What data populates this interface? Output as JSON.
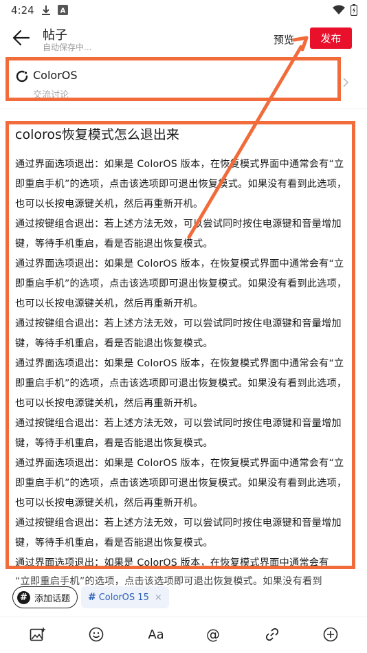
{
  "status_bar": {
    "time": "4:24"
  },
  "header": {
    "title": "帖子",
    "subtitle": "自动保存中...",
    "preview_label": "预览",
    "publish_label": "发布"
  },
  "circle": {
    "name": "ColorOS",
    "sub": "交流讨论"
  },
  "post": {
    "title": "coloros恢复模式怎么退出来",
    "paragraphs": [
      "通过界面选项退出：如果是 ColorOS 版本，在恢复模式界面中通常会有“立即重启手机”的选项，点击该选项即可退出恢复模式。如果没有看到此选项，也可以长按电源键关机，然后再重新开机。",
      "通过按键组合退出：若上述方法无效，可以尝试同时按住电源键和音量增加键，等待手机重启，看是否能退出恢复模式。",
      "通过界面选项退出：如果是 ColorOS 版本，在恢复模式界面中通常会有“立即重启手机”的选项，点击该选项即可退出恢复模式。如果没有看到此选项，也可以长按电源键关机，然后再重新开机。",
      "通过按键组合退出：若上述方法无效，可以尝试同时按住电源键和音量增加键，等待手机重启，看是否能退出恢复模式。",
      "通过界面选项退出：如果是 ColorOS 版本，在恢复模式界面中通常会有“立即重启手机”的选项，点击该选项即可退出恢复模式。如果没有看到此选项，也可以长按电源键关机，然后再重新开机。",
      "通过按键组合退出：若上述方法无效，可以尝试同时按住电源键和音量增加键，等待手机重启，看是否能退出恢复模式。",
      "通过界面选项退出：如果是 ColorOS 版本，在恢复模式界面中通常会有“立即重启手机”的选项，点击该选项即可退出恢复模式。如果没有看到此选项，也可以长按电源键关机，然后再重新开机。",
      "通过按键组合退出：若上述方法无效，可以尝试同时按住电源键和音量增加键，等待手机重启，看是否能退出恢复模式。",
      "通过界面选项退出：如果是 ColorOS 版本，在恢复模式界面中通常会有"
    ],
    "overflow_line": "“立即重启手机”的选项，点击该选项即可退出恢复模式。如果没有看到"
  },
  "tags": {
    "add_topic_label": "添加话题",
    "topic_chip": "ColorOS 15",
    "hash_symbol": "#",
    "close_symbol": "×"
  },
  "toolbar": {
    "text_format_label": "Aa",
    "mention_label": "@"
  },
  "icons": {
    "back": "back-arrow-icon",
    "circle": "loading-circle-icon",
    "chevron": "chevron-right-icon",
    "image": "add-image-icon",
    "emoji": "emoji-icon",
    "link": "link-icon",
    "plus": "add-circle-icon"
  },
  "colors": {
    "publish": "#e8102b",
    "annotation": "#f26b3a",
    "tag_bg": "#eef3fb",
    "tag_text": "#2d5fb8"
  }
}
